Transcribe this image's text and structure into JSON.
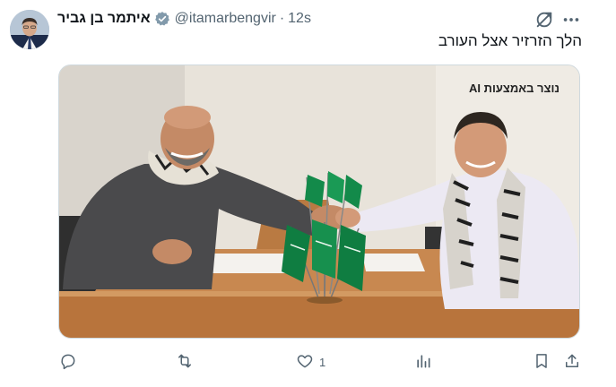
{
  "author": {
    "display_name": "איתמר בן גביר",
    "handle": "@itamarbengvir",
    "time": "12s",
    "verified": true
  },
  "tweet": {
    "text": "הלך הזרזיר אצל העורב"
  },
  "media": {
    "ai_label": "נוצר באמצעות AI",
    "description_icon": "photo"
  },
  "actions": {
    "reply_count": "",
    "retweet_count": "",
    "like_count": "1",
    "views_count": ""
  },
  "colors": {
    "text_primary": "#0f1419",
    "text_secondary": "#536471",
    "verified_badge": "#829aab",
    "border": "#cfd9de"
  },
  "icons": [
    "grok-icon",
    "more-icon",
    "verified-icon",
    "reply-icon",
    "retweet-icon",
    "like-icon",
    "views-icon",
    "bookmark-icon",
    "share-icon"
  ]
}
